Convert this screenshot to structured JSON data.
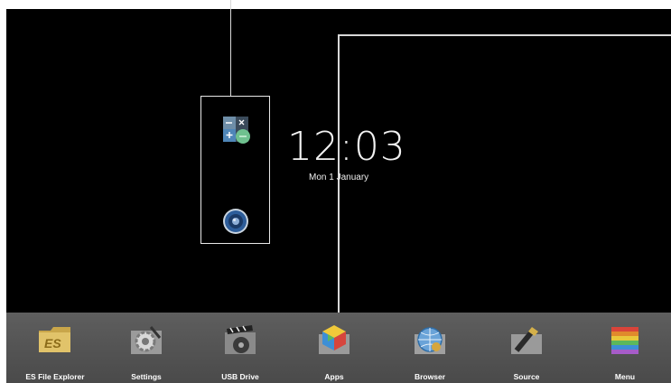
{
  "clock": {
    "time": "12:03",
    "date": "Mon 1 January"
  },
  "desktop_apps": [
    {
      "name": "Calculator",
      "icon": "calculator-icon"
    },
    {
      "name": "Music",
      "icon": "speaker-icon"
    }
  ],
  "dock": {
    "items": [
      {
        "label": "ES File Explorer",
        "icon": "es-folder-icon"
      },
      {
        "label": "Settings",
        "icon": "settings-gear-icon"
      },
      {
        "label": "USB Drive",
        "icon": "film-reel-icon"
      },
      {
        "label": "Apps",
        "icon": "apps-cube-icon"
      },
      {
        "label": "Browser",
        "icon": "globe-icon"
      },
      {
        "label": "Source",
        "icon": "hdmi-cable-icon"
      },
      {
        "label": "Menu",
        "icon": "menu-books-icon"
      }
    ]
  },
  "colors": {
    "screen_bg": "#000000",
    "dock_bg": "#555555",
    "callout": "#d8d8d8"
  }
}
